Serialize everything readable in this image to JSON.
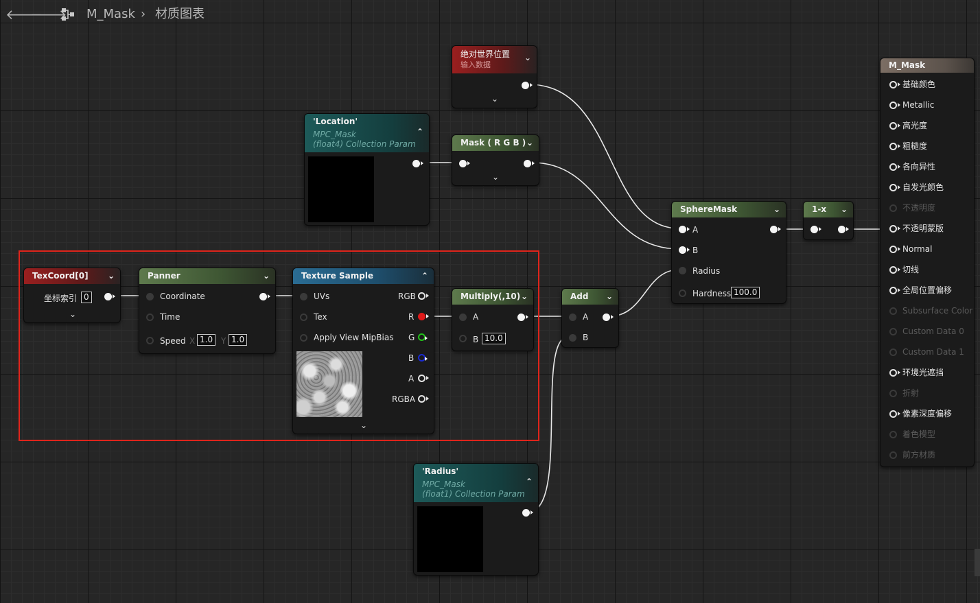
{
  "breadcrumb": {
    "asset": "M_Mask",
    "separator": "›",
    "graph": "材质图表"
  },
  "nodes": {
    "world_position": {
      "title": "绝对世界位置",
      "subtitle": "输入数据"
    },
    "location_param": {
      "title": "'Location'",
      "sub1": "MPC_Mask",
      "sub2": "(float4) Collection Param"
    },
    "mask_rgb": {
      "title": "Mask ( R G B )"
    },
    "sphere_mask": {
      "title": "SphereMask",
      "pin_a": "A",
      "pin_b": "B",
      "pin_radius": "Radius",
      "pin_hardness": "Hardness",
      "hardness_value": "100.0"
    },
    "one_minus_x": {
      "title": "1-x"
    },
    "texcoord": {
      "title": "TexCoord[0]",
      "index_label": "坐标索引",
      "index_value": "0"
    },
    "panner": {
      "title": "Panner",
      "pin_coordinate": "Coordinate",
      "pin_time": "Time",
      "pin_speed": "Speed",
      "speed_x_label": "X",
      "speed_x": "1.0",
      "speed_y_label": "Y",
      "speed_y": "1.0"
    },
    "texture_sample": {
      "title": "Texture Sample",
      "pin_uvs": "UVs",
      "pin_tex": "Tex",
      "pin_mip": "Apply View MipBias",
      "out_rgb": "RGB",
      "out_r": "R",
      "out_g": "G",
      "out_b": "B",
      "out_a": "A",
      "out_rgba": "RGBA"
    },
    "multiply": {
      "title": "Multiply(,10)",
      "pin_a": "A",
      "pin_b": "B",
      "b_value": "10.0"
    },
    "add": {
      "title": "Add",
      "pin_a": "A",
      "pin_b": "B"
    },
    "radius_param": {
      "title": "'Radius'",
      "sub1": "MPC_Mask",
      "sub2": "(float1) Collection Param"
    }
  },
  "result_node": {
    "title": "M_Mask",
    "pins": [
      {
        "label": "基础颜色",
        "enabled": true
      },
      {
        "label": "Metallic",
        "enabled": true
      },
      {
        "label": "高光度",
        "enabled": true
      },
      {
        "label": "粗糙度",
        "enabled": true
      },
      {
        "label": "各向异性",
        "enabled": true
      },
      {
        "label": "自发光颜色",
        "enabled": true
      },
      {
        "label": "不透明度",
        "enabled": false
      },
      {
        "label": "不透明蒙版",
        "enabled": true
      },
      {
        "label": "Normal",
        "enabled": true
      },
      {
        "label": "切线",
        "enabled": true
      },
      {
        "label": "全局位置偏移",
        "enabled": true
      },
      {
        "label": "Subsurface Color",
        "enabled": false
      },
      {
        "label": "Custom Data 0",
        "enabled": false
      },
      {
        "label": "Custom Data 1",
        "enabled": false
      },
      {
        "label": "环境光遮挡",
        "enabled": true
      },
      {
        "label": "折射",
        "enabled": false
      },
      {
        "label": "像素深度偏移",
        "enabled": true
      },
      {
        "label": "着色模型",
        "enabled": false
      },
      {
        "label": "前方材质",
        "enabled": false
      }
    ]
  },
  "colors": {
    "selection": "#e0241b",
    "pin_r": "#e01a1a",
    "pin_g": "#22c01a",
    "pin_b": "#1a2ad0"
  }
}
